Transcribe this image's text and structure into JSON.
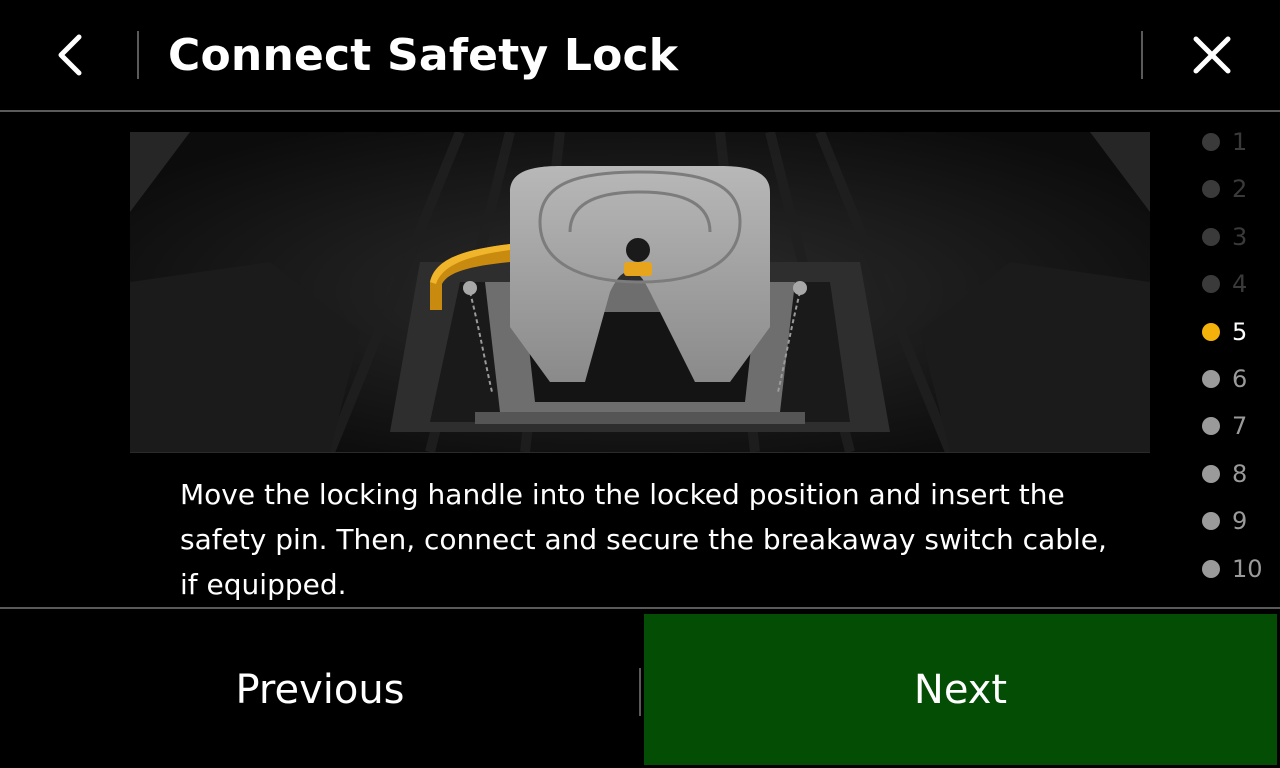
{
  "header": {
    "title": "Connect Safety Lock",
    "back_icon": "chevron-left-icon",
    "close_icon": "close-icon"
  },
  "illustration": {
    "name": "fifth-wheel-hitch-illustration"
  },
  "instruction": {
    "text": "Move the locking handle into the locked position and insert the safety pin. Then, connect and secure the breakaway switch cable, if equipped."
  },
  "steps": {
    "items": [
      "1",
      "2",
      "3",
      "4",
      "5",
      "6",
      "7",
      "8",
      "9",
      "10"
    ],
    "current": 5,
    "active_color": "#f5b20a",
    "visited_color": "#3a3a3a",
    "upcoming_color": "#9a9a9a"
  },
  "footer": {
    "previous_label": "Previous",
    "next_label": "Next",
    "next_color": "#044d04"
  }
}
